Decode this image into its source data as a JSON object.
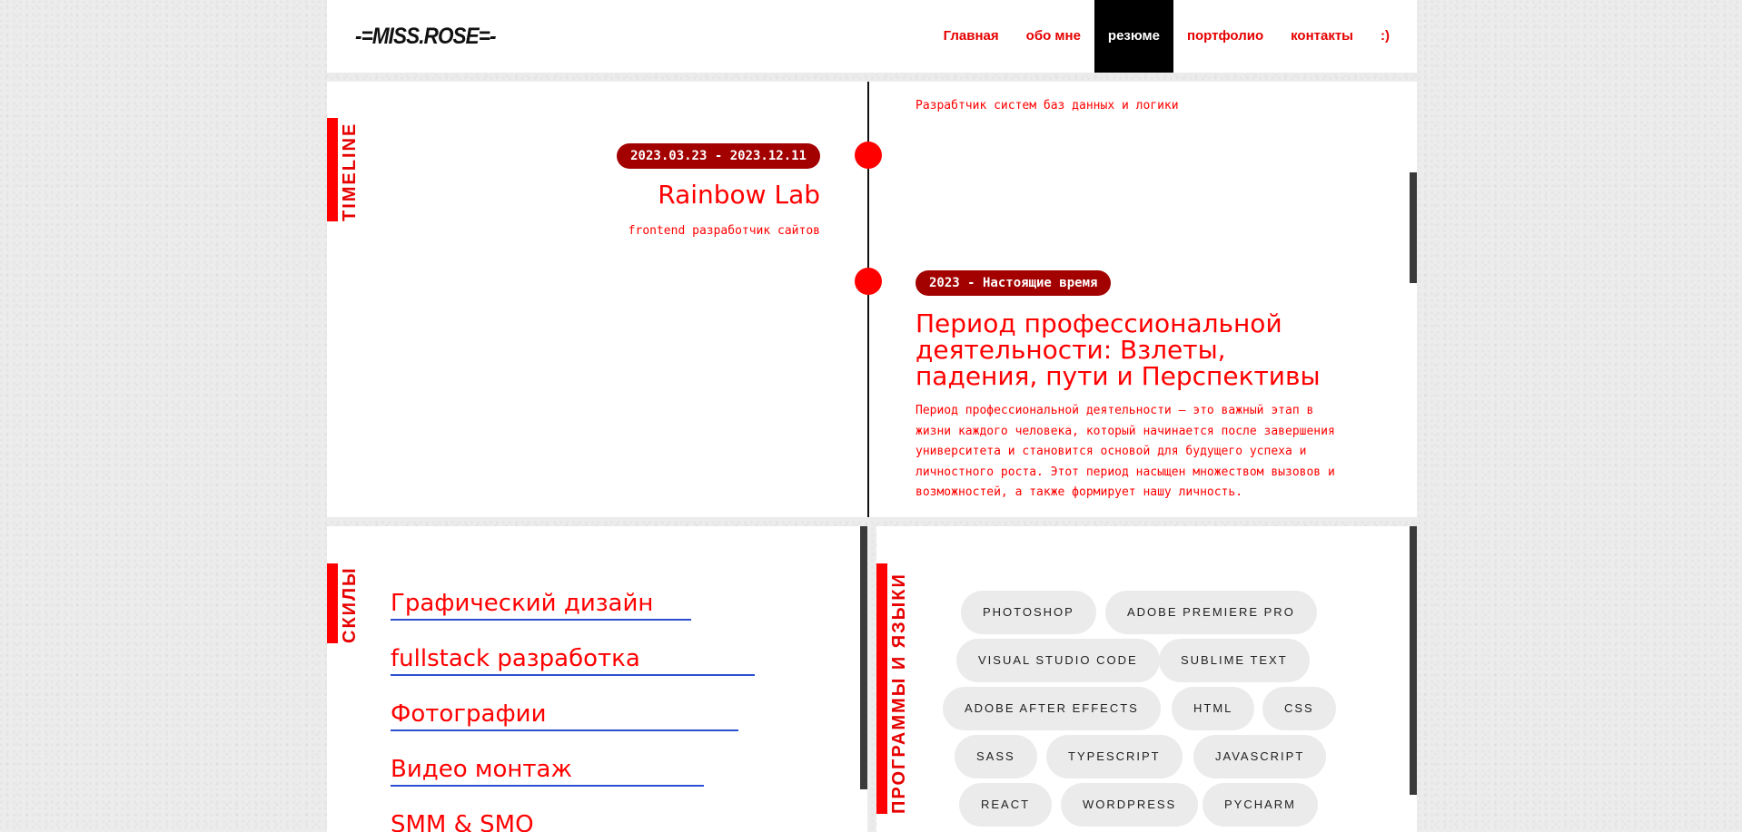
{
  "header": {
    "logo": "-=MISS.ROSE=-",
    "nav": [
      "Главная",
      "обо мне",
      "резюме",
      "портфолио",
      "контакты",
      ":)"
    ],
    "active": "резюме"
  },
  "timeline": {
    "label": "TIMELINE",
    "top_desc": "Разрабтчик систем баз данных и логики",
    "entries": [
      {
        "date": "2023.03.23 - 2023.12.11",
        "title": "Rainbow Lab",
        "desc": "frontend разработчик сайтов"
      },
      {
        "date": "2023 - Настоящие время",
        "title": "Период профессиональной деятельности: Взлеты, падения, пути и Перспективы",
        "desc": "Период профессиональной деятельности – это важный этап в жизни каждого человека, который начинается после завершения университета и становится основой для будущего успеха и личностного роста. Этот период насыщен множеством вызовов и возможностей, а также формирует нашу личность."
      }
    ]
  },
  "skills": {
    "label": "СКИЛЫ",
    "items": [
      "Графический дизайн",
      "fullstack разработка",
      "Фотографии",
      "Видео монтаж",
      "SMM & SMO"
    ]
  },
  "programs": {
    "label": "ПРОГРАММЫ И ЯЗЫКИ",
    "tags": [
      "PHOTOSHOP",
      "ADOBE PREMIERE PRO",
      "VISUAL STUDIO CODE",
      "SUBLIME TEXT",
      "ADOBE AFTER EFFECTS",
      "HTML",
      "CSS",
      "SASS",
      "TYPESCRIPT",
      "JAVASCRIPT",
      "REACT",
      "WORDPRESS",
      "PYCHARM"
    ]
  },
  "colors": {
    "accent": "#ff0000",
    "pill": "#a30000",
    "underline": "#2b4fd1"
  }
}
